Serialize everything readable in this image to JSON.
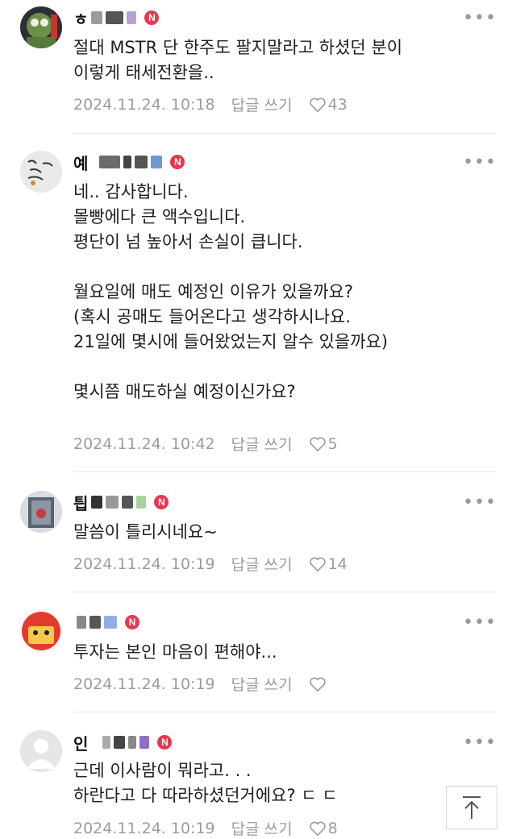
{
  "comments": [
    {
      "name": "ㅎ",
      "lines": [
        "절대 MSTR 단 한주도 팔지말라고 하셨던 분이",
        "이렇게 태세전환을.."
      ],
      "date": "2024.11.24. 10:18",
      "reply_label": "답글 쓰기",
      "likes": "43"
    },
    {
      "name": "예",
      "lines": [
        "네.. 감사합니다.",
        "몰빵에다 큰 액수입니다.",
        "평단이 넘 높아서 손실이 큽니다.",
        "",
        "월요일에 매도 예정인 이유가 있을까요?",
        "(혹시 공매도 들어온다고 생각하시나요.",
        "21일에 몇시에 들어왔었는지 알수 있을까요)",
        "",
        "몇시쯤 매도하실 예정이신가요?"
      ],
      "date": "2024.11.24. 10:42",
      "reply_label": "답글 쓰기",
      "likes": "5"
    },
    {
      "name": "틥",
      "lines": [
        "말씀이 틀리시네요~"
      ],
      "date": "2024.11.24. 10:19",
      "reply_label": "답글 쓰기",
      "likes": "14"
    },
    {
      "name": "",
      "lines": [
        "투자는 본인 마음이 편해야..."
      ],
      "date": "2024.11.24. 10:19",
      "reply_label": "답글 쓰기",
      "likes": ""
    },
    {
      "name": "인",
      "lines": [
        "근데 이사람이 뭐라고. . .",
        "하란다고 다 따라하셨던거에요? ㄷ ㄷ"
      ],
      "date": "2024.11.24. 10:19",
      "reply_label": "답글 쓰기",
      "likes": "8"
    }
  ],
  "badge_label": "N",
  "more_label": "•••",
  "colors": {
    "badge": "#e8384f",
    "meta": "#9c9c9c",
    "divider": "#e4e4e4"
  },
  "icons": {
    "like": "heart-icon",
    "more": "more-icon",
    "scroll_top": "arrow-up-icon"
  }
}
